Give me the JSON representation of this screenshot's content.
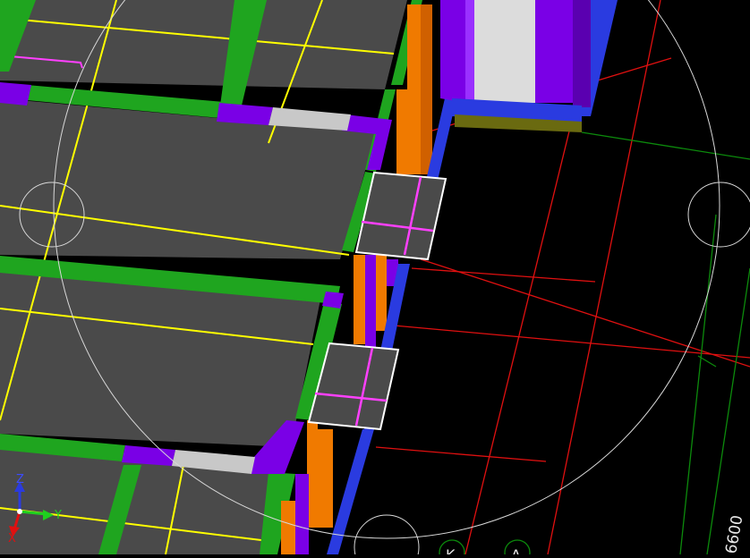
{
  "viewport": {
    "axis_labels": {
      "z": "Z",
      "y": "Y",
      "x": "X"
    },
    "grid_bubbles": [
      {
        "label": "K"
      },
      {
        "label": "A"
      }
    ],
    "dimension_text": "6600",
    "colors": {
      "background": "#000000",
      "slab": "#4a4a4a",
      "beam_green": "#1fa51f",
      "beam_purple": "#7a00e6",
      "beam_light": "#c8c8c8",
      "column_orange": "#f07a00",
      "column_blue": "#2a3be0",
      "grid_red": "#e01010",
      "grid_green": "#0c8a0c",
      "slab_lines": "#ffff00",
      "selection": "#ffffff",
      "opening_lines": "#ff40ff",
      "orbit_circle": "#d8d8d8"
    }
  }
}
